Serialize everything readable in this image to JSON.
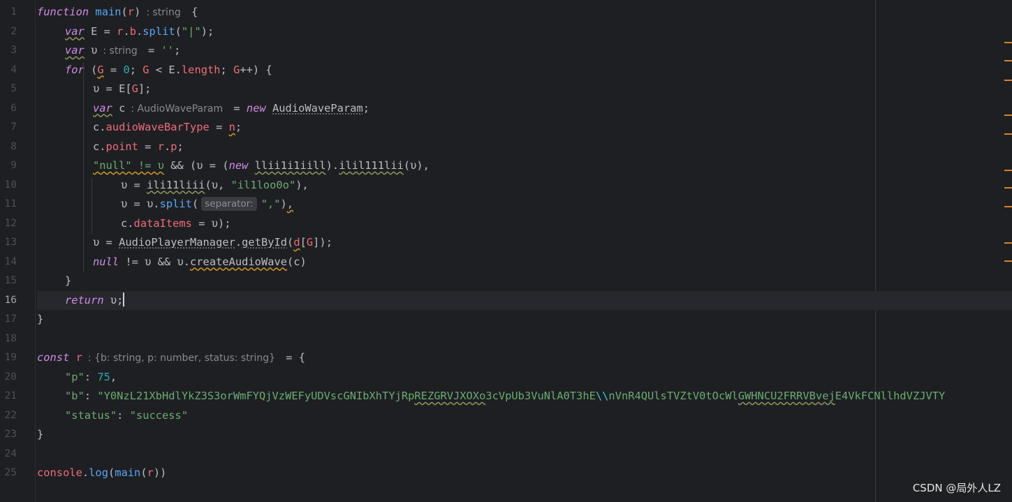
{
  "editor": {
    "current_line": 16,
    "line_numbers": [
      "1",
      "2",
      "3",
      "4",
      "5",
      "6",
      "7",
      "8",
      "9",
      "10",
      "11",
      "12",
      "13",
      "14",
      "15",
      "16",
      "17",
      "18",
      "19",
      "20",
      "21",
      "22",
      "23",
      "24",
      "25"
    ],
    "lines": [
      {
        "tokens": [
          {
            "t": "function",
            "c": "kw"
          },
          {
            "t": " "
          },
          {
            "t": "main",
            "c": "fn"
          },
          {
            "t": "("
          },
          {
            "t": "r",
            "c": "param"
          },
          {
            "t": ")"
          },
          {
            "t": ": string",
            "c": "hint"
          },
          {
            "t": " {"
          }
        ]
      },
      {
        "indent": 1,
        "tokens": [
          {
            "t": "var",
            "c": "kw typo"
          },
          {
            "t": " E = "
          },
          {
            "t": "r",
            "c": "param"
          },
          {
            "t": "."
          },
          {
            "t": "b",
            "c": "prop"
          },
          {
            "t": "."
          },
          {
            "t": "split",
            "c": "fn"
          },
          {
            "t": "("
          },
          {
            "t": "\"|\"",
            "c": "str"
          },
          {
            "t": ");"
          }
        ]
      },
      {
        "indent": 1,
        "tokens": [
          {
            "t": "var",
            "c": "kw typo"
          },
          {
            "t": " υ"
          },
          {
            "t": ": string",
            "c": "hint"
          },
          {
            "t": " = "
          },
          {
            "t": "''",
            "c": "str"
          },
          {
            "t": ";"
          }
        ]
      },
      {
        "indent": 1,
        "tokens": [
          {
            "t": "for",
            "c": "kw"
          },
          {
            "t": " ("
          },
          {
            "t": "G",
            "c": "prop warn"
          },
          {
            "t": " = "
          },
          {
            "t": "0",
            "c": "num"
          },
          {
            "t": "; "
          },
          {
            "t": "G",
            "c": "prop"
          },
          {
            "t": " < E."
          },
          {
            "t": "length",
            "c": "prop"
          },
          {
            "t": "; "
          },
          {
            "t": "G",
            "c": "prop"
          },
          {
            "t": "++) {"
          }
        ]
      },
      {
        "indent": 2,
        "tokens": [
          {
            "t": "υ = E["
          },
          {
            "t": "G",
            "c": "prop"
          },
          {
            "t": "];"
          }
        ]
      },
      {
        "indent": 2,
        "tokens": [
          {
            "t": "var",
            "c": "kw typo"
          },
          {
            "t": " c"
          },
          {
            "t": ": AudioWaveParam",
            "c": "hint"
          },
          {
            "t": " = "
          },
          {
            "t": "new",
            "c": "kw"
          },
          {
            "t": " "
          },
          {
            "t": "AudioWaveParam",
            "c": "cls dotted"
          },
          {
            "t": ";"
          }
        ]
      },
      {
        "indent": 2,
        "tokens": [
          {
            "t": "c."
          },
          {
            "t": "audioWaveBarType",
            "c": "prop"
          },
          {
            "t": " = "
          },
          {
            "t": "n",
            "c": "prop warn"
          },
          {
            "t": ";"
          }
        ]
      },
      {
        "indent": 2,
        "tokens": [
          {
            "t": "c."
          },
          {
            "t": "point",
            "c": "prop"
          },
          {
            "t": " = "
          },
          {
            "t": "r",
            "c": "param"
          },
          {
            "t": "."
          },
          {
            "t": "p",
            "c": "prop"
          },
          {
            "t": ";"
          }
        ]
      },
      {
        "indent": 2,
        "tokens": [
          {
            "t": "\"null\" != υ",
            "c": "str warn"
          },
          {
            "t": " && (υ = ("
          },
          {
            "t": "new",
            "c": "kw"
          },
          {
            "t": " "
          },
          {
            "t": "llii1i1iill",
            "c": "cls typo"
          },
          {
            "t": ")."
          },
          {
            "t": "ilil111lii",
            "c": "cls typo"
          },
          {
            "t": "(υ),"
          }
        ]
      },
      {
        "indent": 3,
        "tokens": [
          {
            "t": "υ = "
          },
          {
            "t": "ili11liii",
            "c": "cls typo"
          },
          {
            "t": "(υ, "
          },
          {
            "t": "\"il1loo0o\"",
            "c": "str"
          },
          {
            "t": "),"
          }
        ]
      },
      {
        "indent": 3,
        "tokens": [
          {
            "t": "υ = υ."
          },
          {
            "t": "split",
            "c": "fn"
          },
          {
            "t": "("
          },
          {
            "t": "separator:",
            "c": "hintbox"
          },
          {
            "t": "\",\"",
            "c": "str"
          },
          {
            "t": ")"
          },
          {
            "t": ",",
            "c": "warn"
          }
        ]
      },
      {
        "indent": 3,
        "tokens": [
          {
            "t": "c."
          },
          {
            "t": "dataItems",
            "c": "prop"
          },
          {
            "t": " = υ);"
          }
        ]
      },
      {
        "indent": 2,
        "tokens": [
          {
            "t": "υ = "
          },
          {
            "t": "AudioPlayerManager",
            "c": "cls dotted"
          },
          {
            "t": "."
          },
          {
            "t": "getById",
            "c": "cls dotted"
          },
          {
            "t": "("
          },
          {
            "t": "d",
            "c": "prop warn"
          },
          {
            "t": "["
          },
          {
            "t": "G",
            "c": "prop"
          },
          {
            "t": "]);"
          }
        ]
      },
      {
        "indent": 2,
        "tokens": [
          {
            "t": "null",
            "c": "kw"
          },
          {
            "t": " != υ && υ."
          },
          {
            "t": "createAudioWave",
            "c": "cls warn"
          },
          {
            "t": "(c)"
          }
        ]
      },
      {
        "indent": 1,
        "tokens": [
          {
            "t": "}"
          }
        ]
      },
      {
        "indent": 1,
        "caret": true,
        "tokens": [
          {
            "t": "return",
            "c": "kw"
          },
          {
            "t": " υ;"
          }
        ]
      },
      {
        "tokens": [
          {
            "t": "}"
          }
        ]
      },
      {
        "tokens": []
      },
      {
        "tokens": [
          {
            "t": "const",
            "c": "kw"
          },
          {
            "t": " "
          },
          {
            "t": "r",
            "c": "param"
          },
          {
            "t": ": {b: string, p: number, status: string}",
            "c": "hint"
          },
          {
            "t": " = {"
          }
        ]
      },
      {
        "indent": 1,
        "tokens": [
          {
            "t": "\"p\"",
            "c": "str"
          },
          {
            "t": ": "
          },
          {
            "t": "75",
            "c": "num"
          },
          {
            "t": ","
          }
        ]
      },
      {
        "indent": 1,
        "tokens": [
          {
            "t": "\"b\"",
            "c": "str"
          },
          {
            "t": ": "
          },
          {
            "t": "\"Y0NzL21XbHdlYkZ3S3orWmFYQjVzWEFyUDVscGNIbXhTYjRp",
            "c": "str"
          },
          {
            "t": "REZGRVJXOXo",
            "c": "str typo"
          },
          {
            "t": "3cVpUb3VuNlA0T3hE",
            "c": "str"
          },
          {
            "t": "\\\\",
            "c": "esc"
          },
          {
            "t": "nVnR4QUlsTVZtV0tOcWl",
            "c": "str"
          },
          {
            "t": "GWHNCU2FRRVBvej",
            "c": "str typo"
          },
          {
            "t": "E4VkFCNllhdVZJVTY",
            "c": "str"
          }
        ]
      },
      {
        "indent": 1,
        "tokens": [
          {
            "t": "\"status\"",
            "c": "str"
          },
          {
            "t": ": "
          },
          {
            "t": "\"success\"",
            "c": "str"
          }
        ]
      },
      {
        "tokens": [
          {
            "t": "}"
          }
        ]
      },
      {
        "tokens": []
      },
      {
        "tokens": [
          {
            "t": "console",
            "c": "prop"
          },
          {
            "t": "."
          },
          {
            "t": "log",
            "c": "fn"
          },
          {
            "t": "("
          },
          {
            "t": "main",
            "c": "fn"
          },
          {
            "t": "("
          },
          {
            "t": "r",
            "c": "param"
          },
          {
            "t": "))"
          }
        ]
      }
    ]
  },
  "watermark": "CSDN @局外人LZ",
  "colors": {
    "background": "#1e1f22",
    "keyword": "#cf8ee6",
    "function": "#56a8f5",
    "property": "#ee6d7c",
    "string": "#6aab73",
    "number": "#2aacb8",
    "warning_marker": "#d9822b"
  }
}
